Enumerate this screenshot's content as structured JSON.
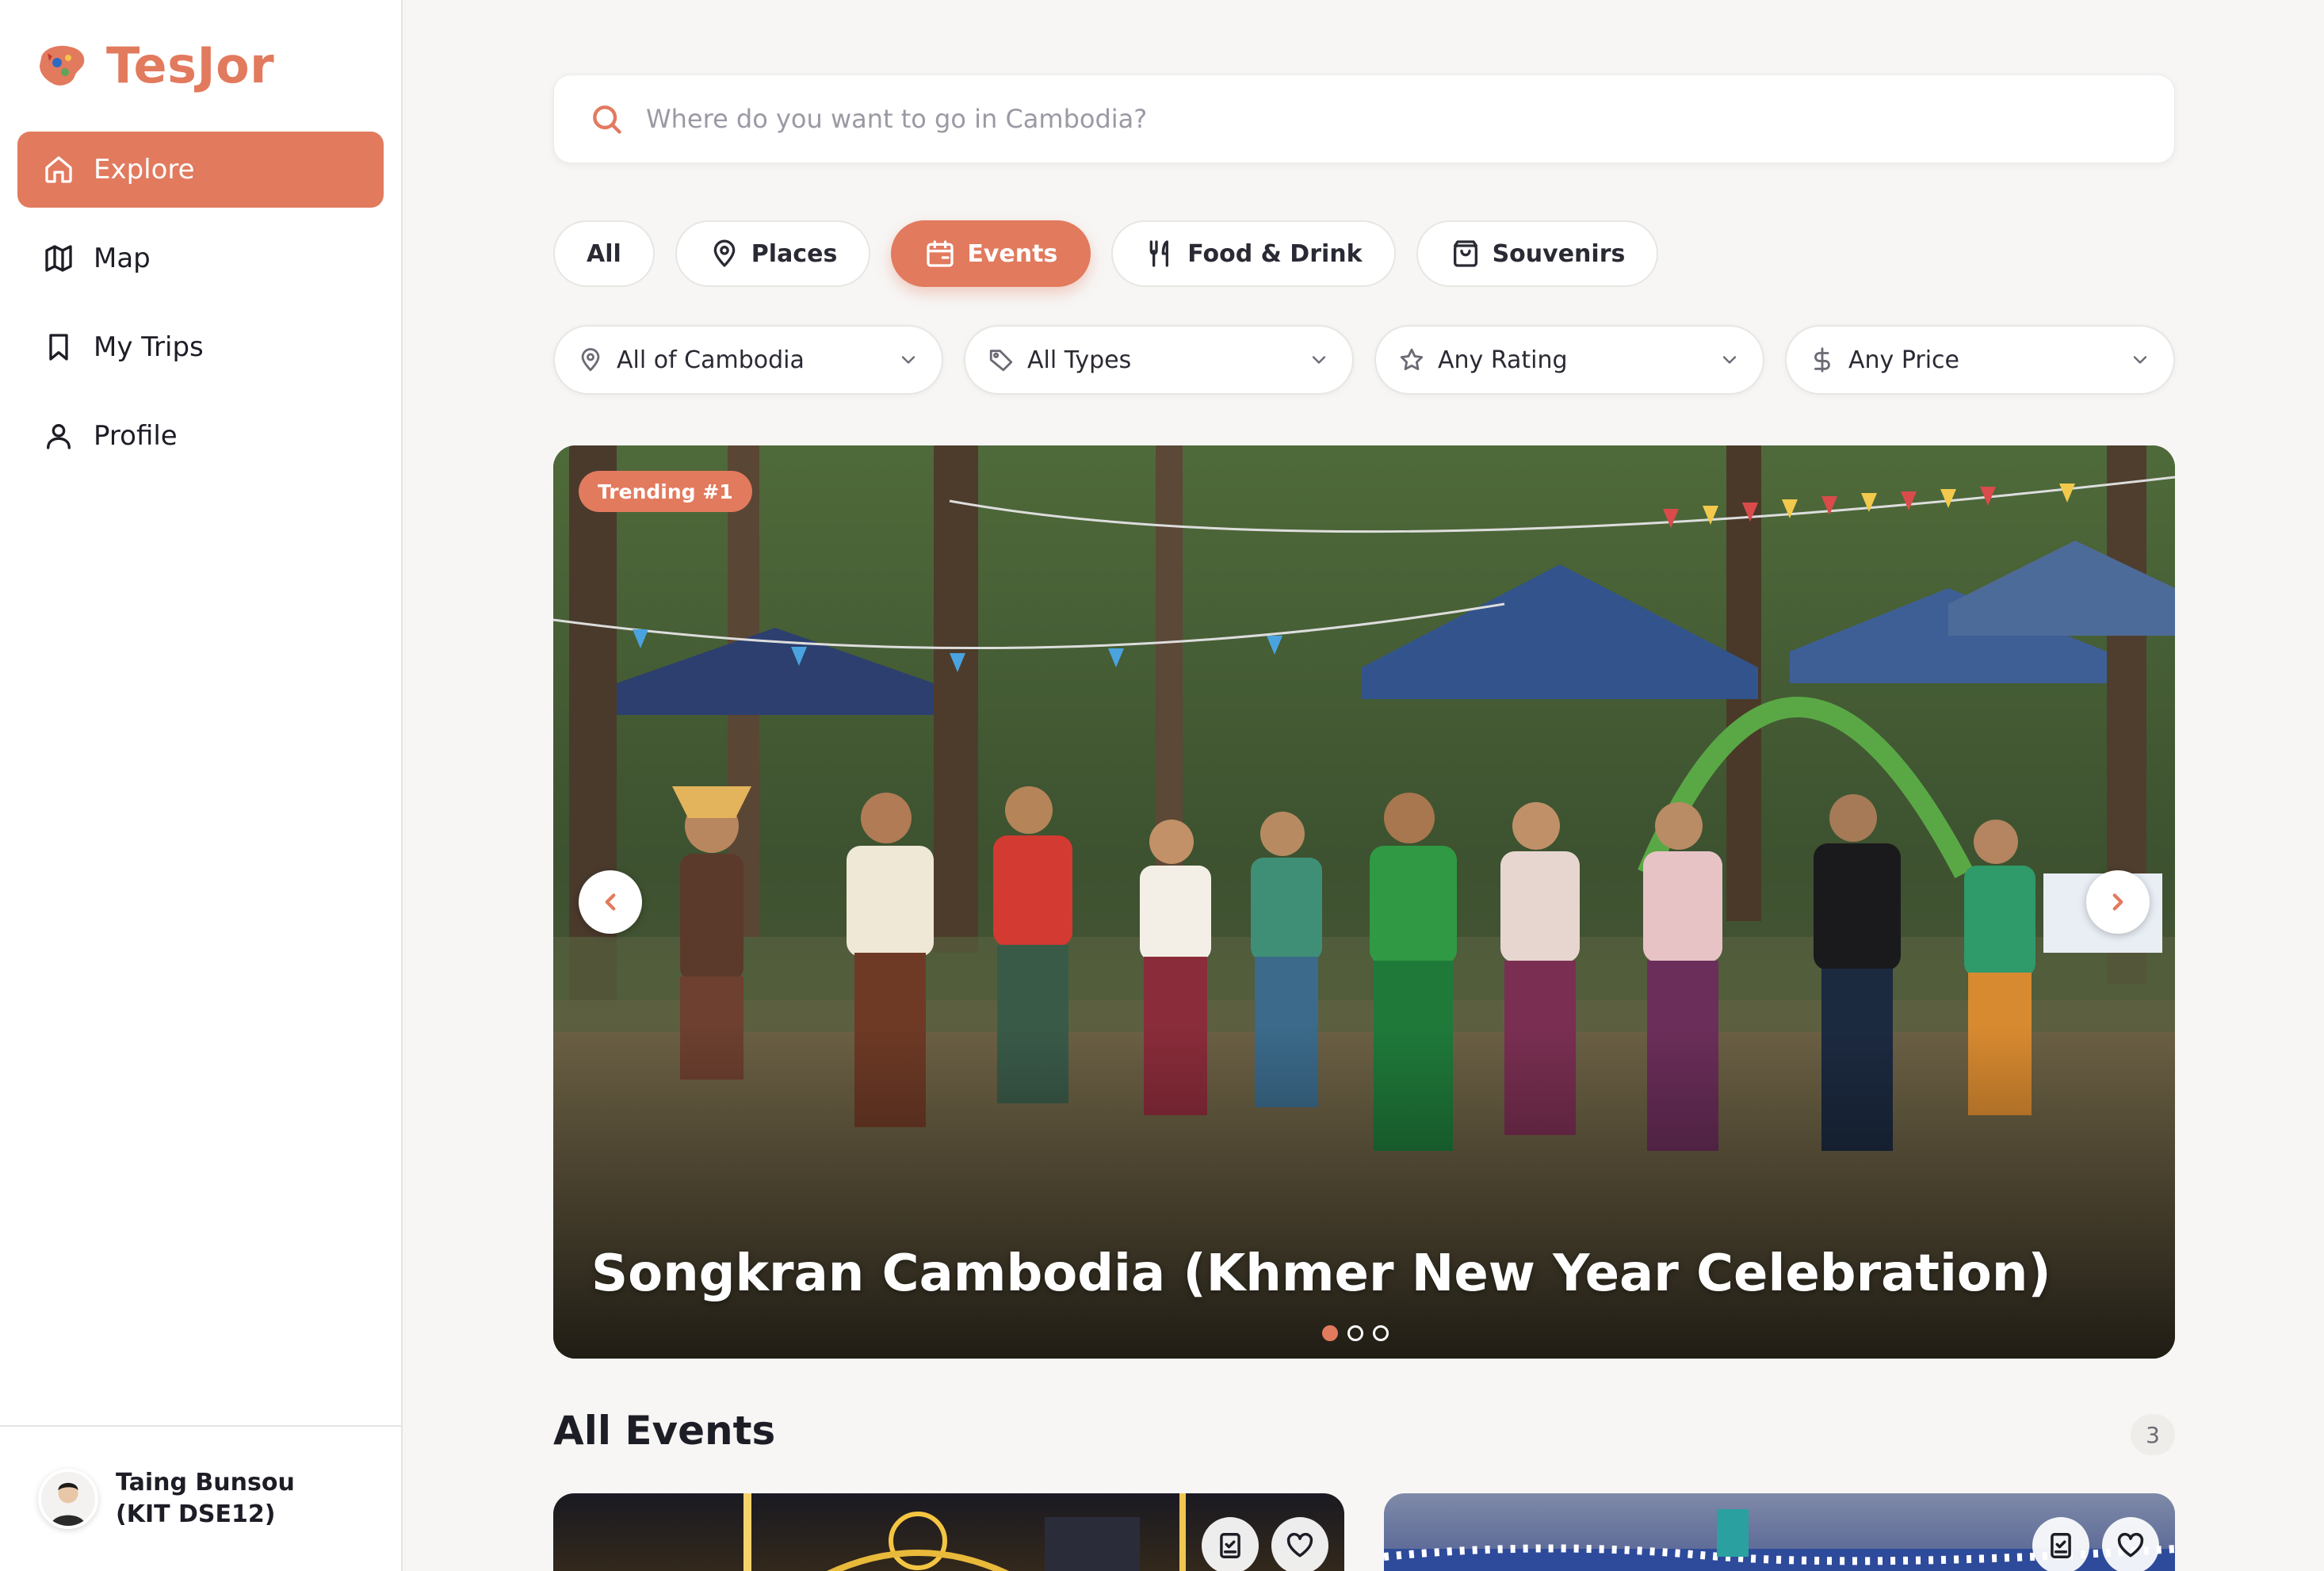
{
  "brand": {
    "name": "TesJor"
  },
  "nav": {
    "items": [
      {
        "label": "Explore",
        "icon": "home-icon",
        "active": true
      },
      {
        "label": "Map",
        "icon": "map-icon",
        "active": false
      },
      {
        "label": "My Trips",
        "icon": "bookmark-icon",
        "active": false
      },
      {
        "label": "Profile",
        "icon": "user-icon",
        "active": false
      }
    ]
  },
  "user": {
    "name": "Taing Bunsou (KIT DSE12)"
  },
  "search": {
    "placeholder": "Where do you want to go in Cambodia?"
  },
  "categories": [
    {
      "label": "All",
      "icon": "",
      "active": false
    },
    {
      "label": "Places",
      "icon": "pin-icon",
      "active": false
    },
    {
      "label": "Events",
      "icon": "calendar-icon",
      "active": true
    },
    {
      "label": "Food & Drink",
      "icon": "utensils-icon",
      "active": false
    },
    {
      "label": "Souvenirs",
      "icon": "shopping-bag-icon",
      "active": false
    }
  ],
  "filters": [
    {
      "label": "All of Cambodia",
      "icon": "location-icon"
    },
    {
      "label": "All Types",
      "icon": "tag-icon"
    },
    {
      "label": "Any Rating",
      "icon": "star-icon"
    },
    {
      "label": "Any Price",
      "icon": "dollar-icon"
    }
  ],
  "hero": {
    "badge": "Trending #1",
    "title": "Songkran Cambodia (Khmer New Year Celebration)",
    "slides_total": 3,
    "active_slide": 1
  },
  "section": {
    "title": "All Events",
    "count": "3"
  },
  "colors": {
    "accent": "#e27a5e",
    "background": "#f7f6f5",
    "text": "#1d1d26"
  }
}
